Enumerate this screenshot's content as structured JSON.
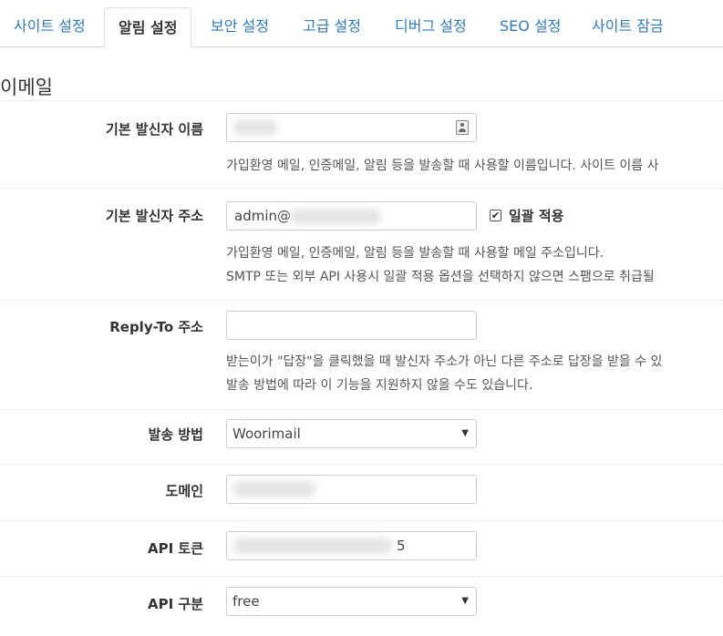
{
  "tabs": [
    {
      "label": "사이트 설정",
      "active": false
    },
    {
      "label": "알림 설정",
      "active": true
    },
    {
      "label": "보안 설정",
      "active": false
    },
    {
      "label": "고급 설정",
      "active": false
    },
    {
      "label": "디버그 설정",
      "active": false
    },
    {
      "label": "SEO 설정",
      "active": false
    },
    {
      "label": "사이트 잠금",
      "active": false
    }
  ],
  "section": {
    "title": "이메일"
  },
  "fields": {
    "sender_name": {
      "label": "기본 발신자 이름",
      "value": "",
      "help": "가입환영 메일, 인증메일, 알림 등을 발송할 때 사용할 이름입니다. 사이트 이름 사"
    },
    "sender_address": {
      "label": "기본 발신자 주소",
      "value": "admin@",
      "bulk_apply_label": "일괄 적용",
      "bulk_apply_checked": true,
      "help_line1": "가입환영 메일, 인증메일, 알림 등을 발송할 때 사용할 메일 주소입니다.",
      "help_line2": "SMTP 또는 외부 API 사용시 일괄 적용 옵션을 선택하지 않으면 스팸으로 취급될"
    },
    "reply_to": {
      "label": "Reply-To 주소",
      "value": "",
      "help_line1": "받는이가 \"답장\"을 클릭했을 때 발신자 주소가 아닌 다른 주소로 답장을 받을 수 있",
      "help_line2": "발송 방법에 따라 이 기능을 지원하지 않을 수도 있습니다."
    },
    "send_method": {
      "label": "발송 방법",
      "value": "Woorimail"
    },
    "domain": {
      "label": "도메인",
      "value": ""
    },
    "api_token": {
      "label": "API 토큰",
      "value": "5"
    },
    "api_type": {
      "label": "API 구분",
      "value": "free"
    }
  },
  "icons": {
    "check": "✔",
    "caret": "▼"
  }
}
